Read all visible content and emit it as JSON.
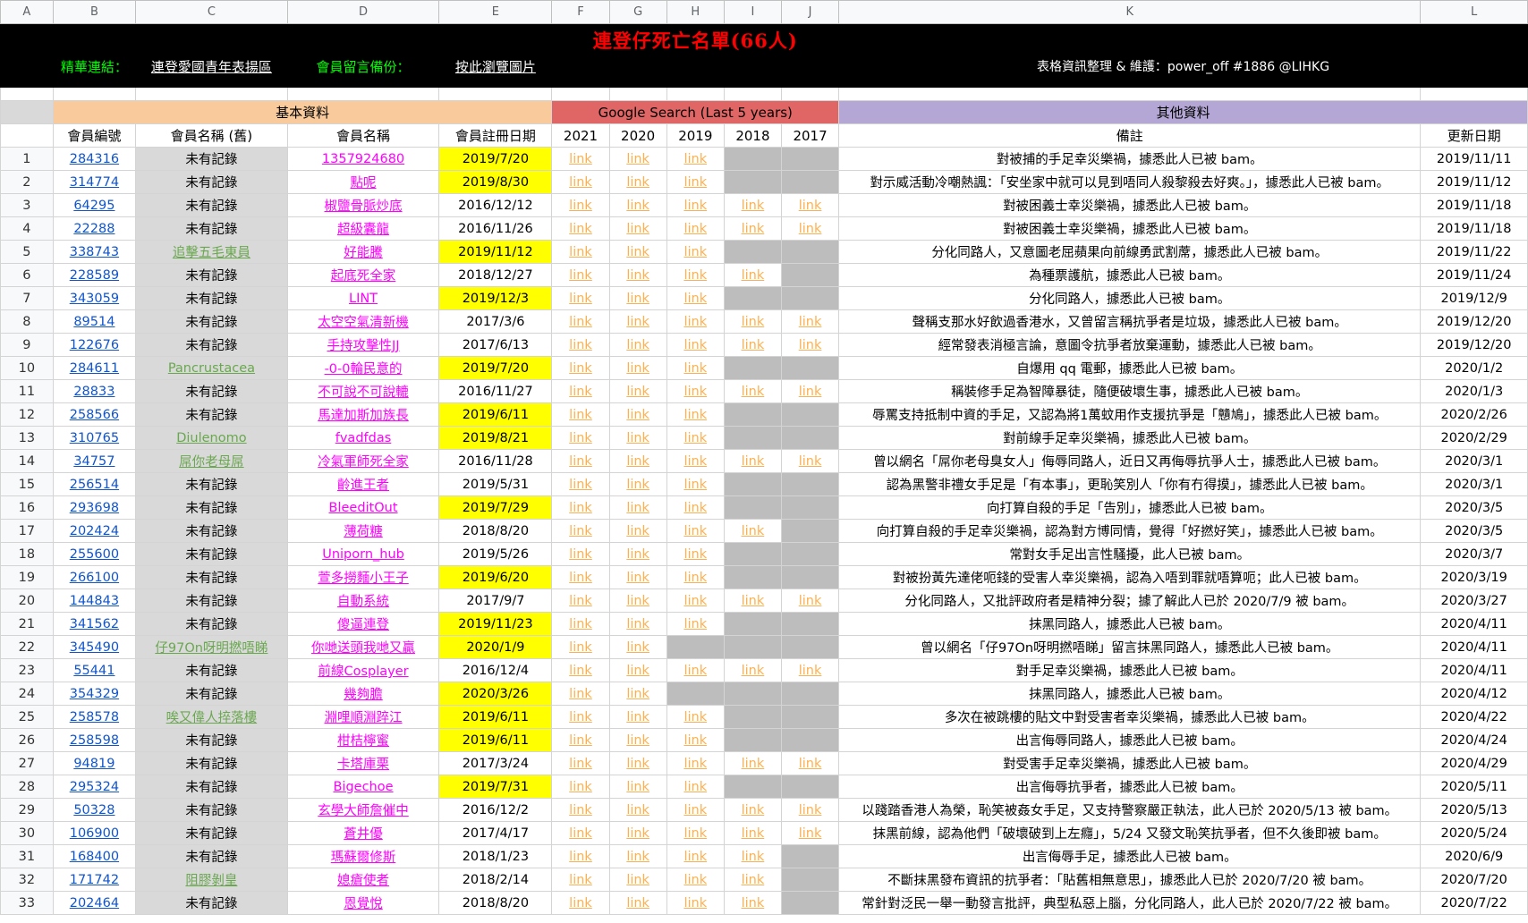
{
  "columns": [
    "A",
    "B",
    "C",
    "D",
    "E",
    "F",
    "G",
    "H",
    "I",
    "J",
    "K",
    "L"
  ],
  "title": "連登仔死亡名單(66人)",
  "links_row": {
    "highlight_label": "精華連結：",
    "highlight_link": "連登愛國青年表揚區",
    "backup_label": "會員留言備份：",
    "backup_link": "按此瀏覽圖片",
    "credit": "表格資訊整理 & 維護：power_off #1886 @LIHKG"
  },
  "groups": {
    "basic": "基本資料",
    "google": "Google Search (Last 5 years)",
    "other": "其他資料"
  },
  "headers": [
    "會員編號",
    "會員名稱 (舊)",
    "會員名稱",
    "會員註冊日期",
    "2021",
    "2020",
    "2019",
    "2018",
    "2017",
    "備註",
    "更新日期"
  ],
  "link_label": "link",
  "colors": {
    "black_banner": "#000000",
    "title_red": "#ff0000",
    "green_text": "#00ff00",
    "basic_orange": "#f9cb9c",
    "google_red": "#e06666",
    "other_purple": "#b4a7d6",
    "highlight_yellow": "#ffff00",
    "link_orange": "#ffb04d",
    "name_pink": "#ff00ff",
    "id_blue": "#1155cc"
  },
  "rows": [
    {
      "n": "1",
      "id": "284316",
      "old": "未有記錄",
      "name": "1357924680",
      "date": "2019/7/20",
      "yellow": true,
      "links": [
        1,
        1,
        1,
        0,
        0
      ],
      "note": "對被捕的手足幸災樂禍，據悉此人已被 bam。",
      "updated": "2019/11/11"
    },
    {
      "n": "2",
      "id": "314774",
      "old": "未有記錄",
      "name": "點呢",
      "date": "2019/8/30",
      "yellow": true,
      "links": [
        1,
        1,
        1,
        0,
        0
      ],
      "note": "對示威活動冷嘲熱諷：「安坐家中就可以見到唔同人殺黎殺去好爽。」，據悉此人已被 bam。",
      "updated": "2019/11/12"
    },
    {
      "n": "3",
      "id": "64295",
      "old": "未有記錄",
      "name": "椒鹽骨脈炒底",
      "date": "2016/12/12",
      "yellow": false,
      "links": [
        1,
        1,
        1,
        1,
        1
      ],
      "note": "對被困義士幸災樂禍，據悉此人已被 bam。",
      "updated": "2019/11/18"
    },
    {
      "n": "4",
      "id": "22288",
      "old": "未有記錄",
      "name": "超級囊龍",
      "date": "2016/11/26",
      "yellow": false,
      "links": [
        1,
        1,
        1,
        1,
        1
      ],
      "note": "對被困義士幸災樂禍，據悉此人已被 bam。",
      "updated": "2019/11/18"
    },
    {
      "n": "5",
      "id": "338743",
      "old": "追擊五毛東員",
      "name": "好能騰",
      "date": "2019/11/12",
      "yellow": true,
      "links": [
        1,
        1,
        1,
        0,
        0
      ],
      "note": "分化同路人，又意圖老屈蘋果向前線勇武割蓆，據悉此人已被 bam。",
      "updated": "2019/11/22"
    },
    {
      "n": "6",
      "id": "228589",
      "old": "未有記錄",
      "name": "起底死全家",
      "date": "2018/12/27",
      "yellow": false,
      "links": [
        1,
        1,
        1,
        1,
        0
      ],
      "note": "為種票護航，據悉此人已被 bam。",
      "updated": "2019/11/24"
    },
    {
      "n": "7",
      "id": "343059",
      "old": "未有記錄",
      "name": "LINT",
      "date": "2019/12/3",
      "yellow": true,
      "links": [
        1,
        1,
        1,
        0,
        0
      ],
      "note": "分化同路人，據悉此人已被 bam。",
      "updated": "2019/12/9"
    },
    {
      "n": "8",
      "id": "89514",
      "old": "未有記錄",
      "name": "太空空氣清新機",
      "date": "2017/3/6",
      "yellow": false,
      "links": [
        1,
        1,
        1,
        1,
        1
      ],
      "note": "聲稱支那水好飲過香港水，又曾留言稱抗爭者是垃圾，據悉此人已被 bam。",
      "updated": "2019/12/20"
    },
    {
      "n": "9",
      "id": "122676",
      "old": "未有記錄",
      "name": "手持攻擊性JJ",
      "date": "2017/6/13",
      "yellow": false,
      "links": [
        1,
        1,
        1,
        1,
        1
      ],
      "note": "經常發表消極言論，意圖令抗爭者放棄運動，據悉此人已被 bam。",
      "updated": "2019/12/20"
    },
    {
      "n": "10",
      "id": "284611",
      "old": "Pancrustacea",
      "name": "-0-0輪民意的",
      "date": "2019/7/20",
      "yellow": true,
      "links": [
        1,
        1,
        1,
        0,
        0
      ],
      "note": "自爆用 qq 電郵，據悉此人已被 bam。",
      "updated": "2020/1/2"
    },
    {
      "n": "11",
      "id": "28833",
      "old": "未有記錄",
      "name": "不可說不可說轆",
      "date": "2016/11/27",
      "yellow": false,
      "links": [
        1,
        1,
        1,
        1,
        1
      ],
      "note": "稱裝修手足為智障暴徒，隨便破壞生事，據悉此人已被 bam。",
      "updated": "2020/1/3"
    },
    {
      "n": "12",
      "id": "258566",
      "old": "未有記錄",
      "name": "馬達加斯加族長",
      "date": "2019/6/11",
      "yellow": true,
      "links": [
        1,
        1,
        1,
        0,
        0
      ],
      "note": "辱罵支持抵制中資的手足，又認為將1萬蚊用作支援抗爭是「戇鳩」，據悉此人已被 bam。",
      "updated": "2020/2/26"
    },
    {
      "n": "13",
      "id": "310765",
      "old": "Diulenomo",
      "name": "fvadfdas",
      "date": "2019/8/21",
      "yellow": true,
      "links": [
        1,
        1,
        1,
        0,
        0
      ],
      "note": "對前線手足幸災樂禍，據悉此人已被 bam。",
      "updated": "2020/2/29"
    },
    {
      "n": "14",
      "id": "34757",
      "old": "屌你老母屌",
      "name": "冷氣軍師死全家",
      "date": "2016/11/28",
      "yellow": false,
      "links": [
        1,
        1,
        1,
        1,
        1
      ],
      "note": "曾以網名「屌你老母臭女人」侮辱同路人，近日又再侮辱抗爭人士，據悉此人已被 bam。",
      "updated": "2020/3/1"
    },
    {
      "n": "15",
      "id": "256514",
      "old": "未有記錄",
      "name": "齡進王者",
      "date": "2019/5/31",
      "yellow": false,
      "links": [
        1,
        1,
        1,
        0,
        0
      ],
      "note": "認為黑警非禮女手足是「有本事」，更恥笑別人「你有冇得摸」，據悉此人已被 bam。",
      "updated": "2020/3/1"
    },
    {
      "n": "16",
      "id": "293698",
      "old": "未有記錄",
      "name": "BleeditOut",
      "date": "2019/7/29",
      "yellow": true,
      "links": [
        1,
        1,
        1,
        0,
        0
      ],
      "note": "向打算自殺的手足「告別」，據悉此人已被 bam。",
      "updated": "2020/3/5"
    },
    {
      "n": "17",
      "id": "202424",
      "old": "未有記錄",
      "name": "薄荷糖",
      "date": "2018/8/20",
      "yellow": false,
      "links": [
        1,
        1,
        1,
        1,
        0
      ],
      "note": "向打算自殺的手足幸災樂禍，認為對方博同情，覺得「好撚好笑」，據悉此人已被 bam。",
      "updated": "2020/3/5"
    },
    {
      "n": "18",
      "id": "255600",
      "old": "未有記錄",
      "name": "Uniporn_hub",
      "date": "2019/5/26",
      "yellow": false,
      "links": [
        1,
        1,
        1,
        0,
        0
      ],
      "note": "常對女手足出言性騷擾，此人已被 bam。",
      "updated": "2020/3/7"
    },
    {
      "n": "19",
      "id": "266100",
      "old": "未有記錄",
      "name": "萱多撈麵小王子",
      "date": "2019/6/20",
      "yellow": true,
      "links": [
        1,
        1,
        1,
        0,
        0
      ],
      "note": "對被扮黃先達佬呃錢的受害人幸災樂禍，認為入唔到罪就唔算呃；此人已被 bam。",
      "updated": "2020/3/19"
    },
    {
      "n": "20",
      "id": "144843",
      "old": "未有記錄",
      "name": "自動系統",
      "date": "2017/9/7",
      "yellow": false,
      "links": [
        1,
        1,
        1,
        1,
        1
      ],
      "note": "分化同路人，又批評政府者是精神分裂；據了解此人已於 2020/7/9 被 bam。",
      "updated": "2020/3/27"
    },
    {
      "n": "21",
      "id": "341562",
      "old": "未有記錄",
      "name": "傻逼連登",
      "date": "2019/11/23",
      "yellow": true,
      "links": [
        1,
        1,
        1,
        0,
        0
      ],
      "note": "抹黑同路人，據悉此人已被 bam。",
      "updated": "2020/4/11"
    },
    {
      "n": "22",
      "id": "345490",
      "old": "仔97On呀明撚唔睇",
      "name": "你哋送頭我哋又贏",
      "date": "2020/1/9",
      "yellow": true,
      "links": [
        1,
        1,
        0,
        0,
        0
      ],
      "note": "曾以網名「仔97On呀明撚唔睇」留言抹黑同路人，據悉此人已被 bam。",
      "updated": "2020/4/11"
    },
    {
      "n": "23",
      "id": "55441",
      "old": "未有記錄",
      "name": "前線Cosplayer",
      "date": "2016/12/4",
      "yellow": false,
      "links": [
        1,
        1,
        1,
        1,
        1
      ],
      "note": "對手足幸災樂禍，據悉此人已被 bam。",
      "updated": "2020/4/11"
    },
    {
      "n": "24",
      "id": "354329",
      "old": "未有記錄",
      "name": "幾夠膽",
      "date": "2020/3/26",
      "yellow": true,
      "links": [
        1,
        1,
        0,
        0,
        0
      ],
      "note": "抹黑同路人，據悉此人已被 bam。",
      "updated": "2020/4/12"
    },
    {
      "n": "25",
      "id": "258578",
      "old": "唉又偉人捽落樓",
      "name": "淵哩順淵踤江",
      "date": "2019/6/11",
      "yellow": true,
      "links": [
        1,
        1,
        1,
        0,
        0
      ],
      "note": "多次在被跳樓的貼文中對受害者幸災樂禍，據悉此人已被 bam。",
      "updated": "2020/4/22"
    },
    {
      "n": "26",
      "id": "258598",
      "old": "未有記錄",
      "name": "柑桔檸蜜",
      "date": "2019/6/11",
      "yellow": true,
      "links": [
        1,
        1,
        1,
        0,
        0
      ],
      "note": "出言侮辱同路人，據悉此人已被 bam。",
      "updated": "2020/4/24"
    },
    {
      "n": "27",
      "id": "94819",
      "old": "未有記錄",
      "name": "卡塔庫栗",
      "date": "2017/3/24",
      "yellow": false,
      "links": [
        1,
        1,
        1,
        1,
        1
      ],
      "note": "對受害手足幸災樂禍，據悉此人已被 bam。",
      "updated": "2020/4/29"
    },
    {
      "n": "28",
      "id": "295324",
      "old": "未有記錄",
      "name": "Bigechoe",
      "date": "2019/7/31",
      "yellow": true,
      "links": [
        1,
        1,
        1,
        0,
        0
      ],
      "note": "出言侮辱抗爭者，據悉此人已被 bam。",
      "updated": "2020/5/11"
    },
    {
      "n": "29",
      "id": "50328",
      "old": "未有記錄",
      "name": "玄學大師詹催中",
      "date": "2016/12/2",
      "yellow": false,
      "links": [
        1,
        1,
        1,
        1,
        1
      ],
      "note": "以踐踏香港人為榮，恥笑被姦女手足，又支持警察嚴正執法，此人已於 2020/5/13 被 bam。",
      "updated": "2020/5/13"
    },
    {
      "n": "30",
      "id": "106900",
      "old": "未有記錄",
      "name": "蒼井優",
      "date": "2017/4/17",
      "yellow": false,
      "links": [
        1,
        1,
        1,
        1,
        1
      ],
      "note": "抹黑前線，認為他們「破壞破到上左癮」，5/24 又發文恥笑抗爭者，但不久後即被 bam。",
      "updated": "2020/5/24"
    },
    {
      "n": "31",
      "id": "168400",
      "old": "未有記錄",
      "name": "瑪蘇爾修斯",
      "date": "2018/1/23",
      "yellow": false,
      "links": [
        1,
        1,
        1,
        1,
        0
      ],
      "note": "出言侮辱手足，據悉此人已被 bam。",
      "updated": "2020/6/9"
    },
    {
      "n": "32",
      "id": "171742",
      "old": "阻膠剝皇",
      "name": "媳瘡使者",
      "date": "2018/2/14",
      "yellow": false,
      "links": [
        1,
        1,
        1,
        1,
        0
      ],
      "note": "不斷抹黑發布資訊的抗爭者：「貼舊相無意思」，據悉此人已於 2020/7/20 被 bam。",
      "updated": "2020/7/20"
    },
    {
      "n": "33",
      "id": "202464",
      "old": "未有記錄",
      "name": "恩覺悅",
      "date": "2018/8/20",
      "yellow": false,
      "links": [
        1,
        1,
        1,
        1,
        0
      ],
      "note": "常針對泛民一舉一動發言批評，典型私惡上腦，分化同路人，此人已於 2020/7/22 被 bam。",
      "updated": "2020/7/22"
    }
  ]
}
